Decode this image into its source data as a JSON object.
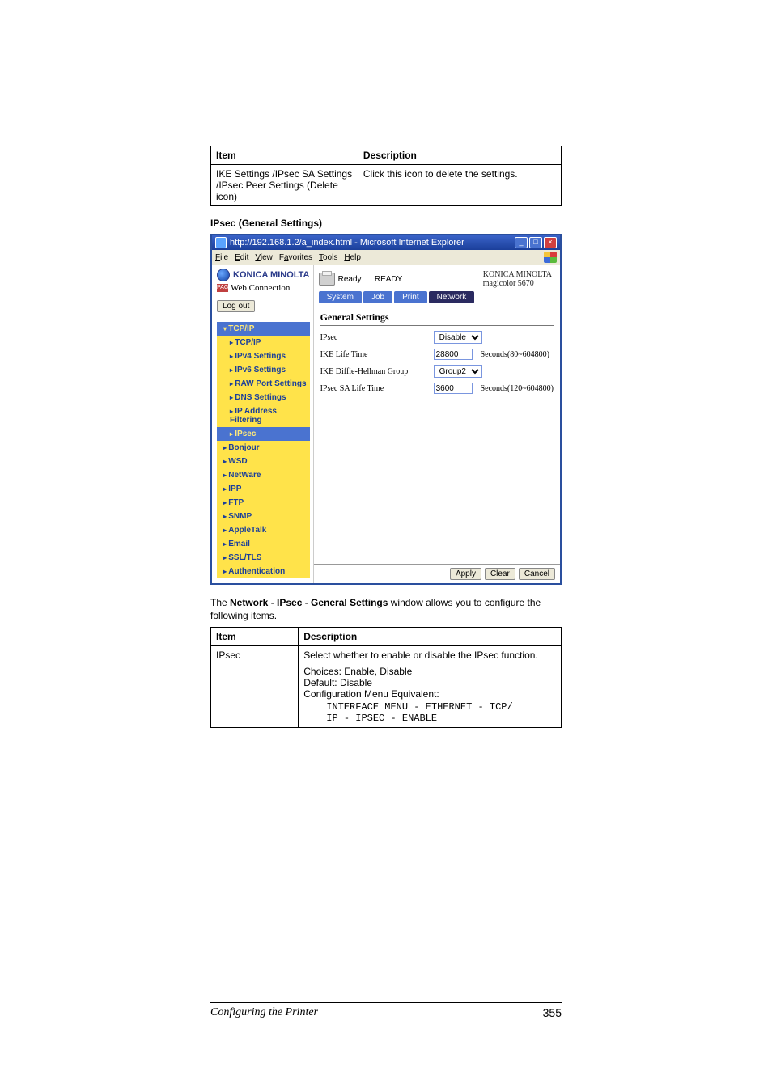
{
  "table1": {
    "headers": [
      "Item",
      "Description"
    ],
    "row": {
      "item": "IKE Settings /IPsec SA Settings /IPsec Peer Settings (Delete icon)",
      "desc": "Click this icon to delete the settings."
    }
  },
  "section_heading": "IPsec (General Settings)",
  "browser": {
    "title": "http://192.168.1.2/a_index.html - Microsoft Internet Explorer",
    "menus": [
      "File",
      "Edit",
      "View",
      "Favorites",
      "Tools",
      "Help"
    ],
    "brand": "KONICA MINOLTA",
    "subbrand": "Web Connection",
    "logout": "Log out",
    "status_label": "Ready",
    "status_value": "READY",
    "device_brand": "KONICA MINOLTA",
    "device_model": "magicolor 5670",
    "tabs": [
      "System",
      "Job",
      "Print",
      "Network"
    ],
    "nav": {
      "group1": "TCP/IP",
      "items1": [
        "TCP/IP",
        "IPv4 Settings",
        "IPv6 Settings",
        "RAW Port Settings",
        "DNS Settings",
        "IP Address Filtering",
        "IPsec"
      ],
      "rest": [
        "Bonjour",
        "WSD",
        "NetWare",
        "IPP",
        "FTP",
        "SNMP",
        "AppleTalk",
        "Email",
        "SSL/TLS",
        "Authentication"
      ]
    },
    "panel": {
      "title": "General Settings",
      "rows": {
        "ipsec_label": "IPsec",
        "ipsec_value": "Disable",
        "ike_label": "IKE Life Time",
        "ike_value": "28800",
        "ike_range": "Seconds(80~604800)",
        "dh_label": "IKE Diffie-Hellman Group",
        "dh_value": "Group2",
        "sa_label": "IPsec SA Life Time",
        "sa_value": "3600",
        "sa_range": "Seconds(120~604800)"
      },
      "buttons": [
        "Apply",
        "Clear",
        "Cancel"
      ]
    }
  },
  "para_prefix": "The ",
  "para_bold": "Network - IPsec - General Settings",
  "para_suffix": " window allows you to configure the following items.",
  "table2": {
    "headers": [
      "Item",
      "Description"
    ],
    "row": {
      "item": "IPsec",
      "line1": "Select whether to enable or disable the IPsec function.",
      "line2": "Choices: Enable, Disable",
      "line3": "Default: Disable",
      "line4": "Configuration Menu Equivalent:",
      "code": "INTERFACE MENU - ETHERNET - TCP/\nIP - IPSEC - ENABLE"
    }
  },
  "footer": {
    "section": "Configuring the Printer",
    "page": "355"
  }
}
